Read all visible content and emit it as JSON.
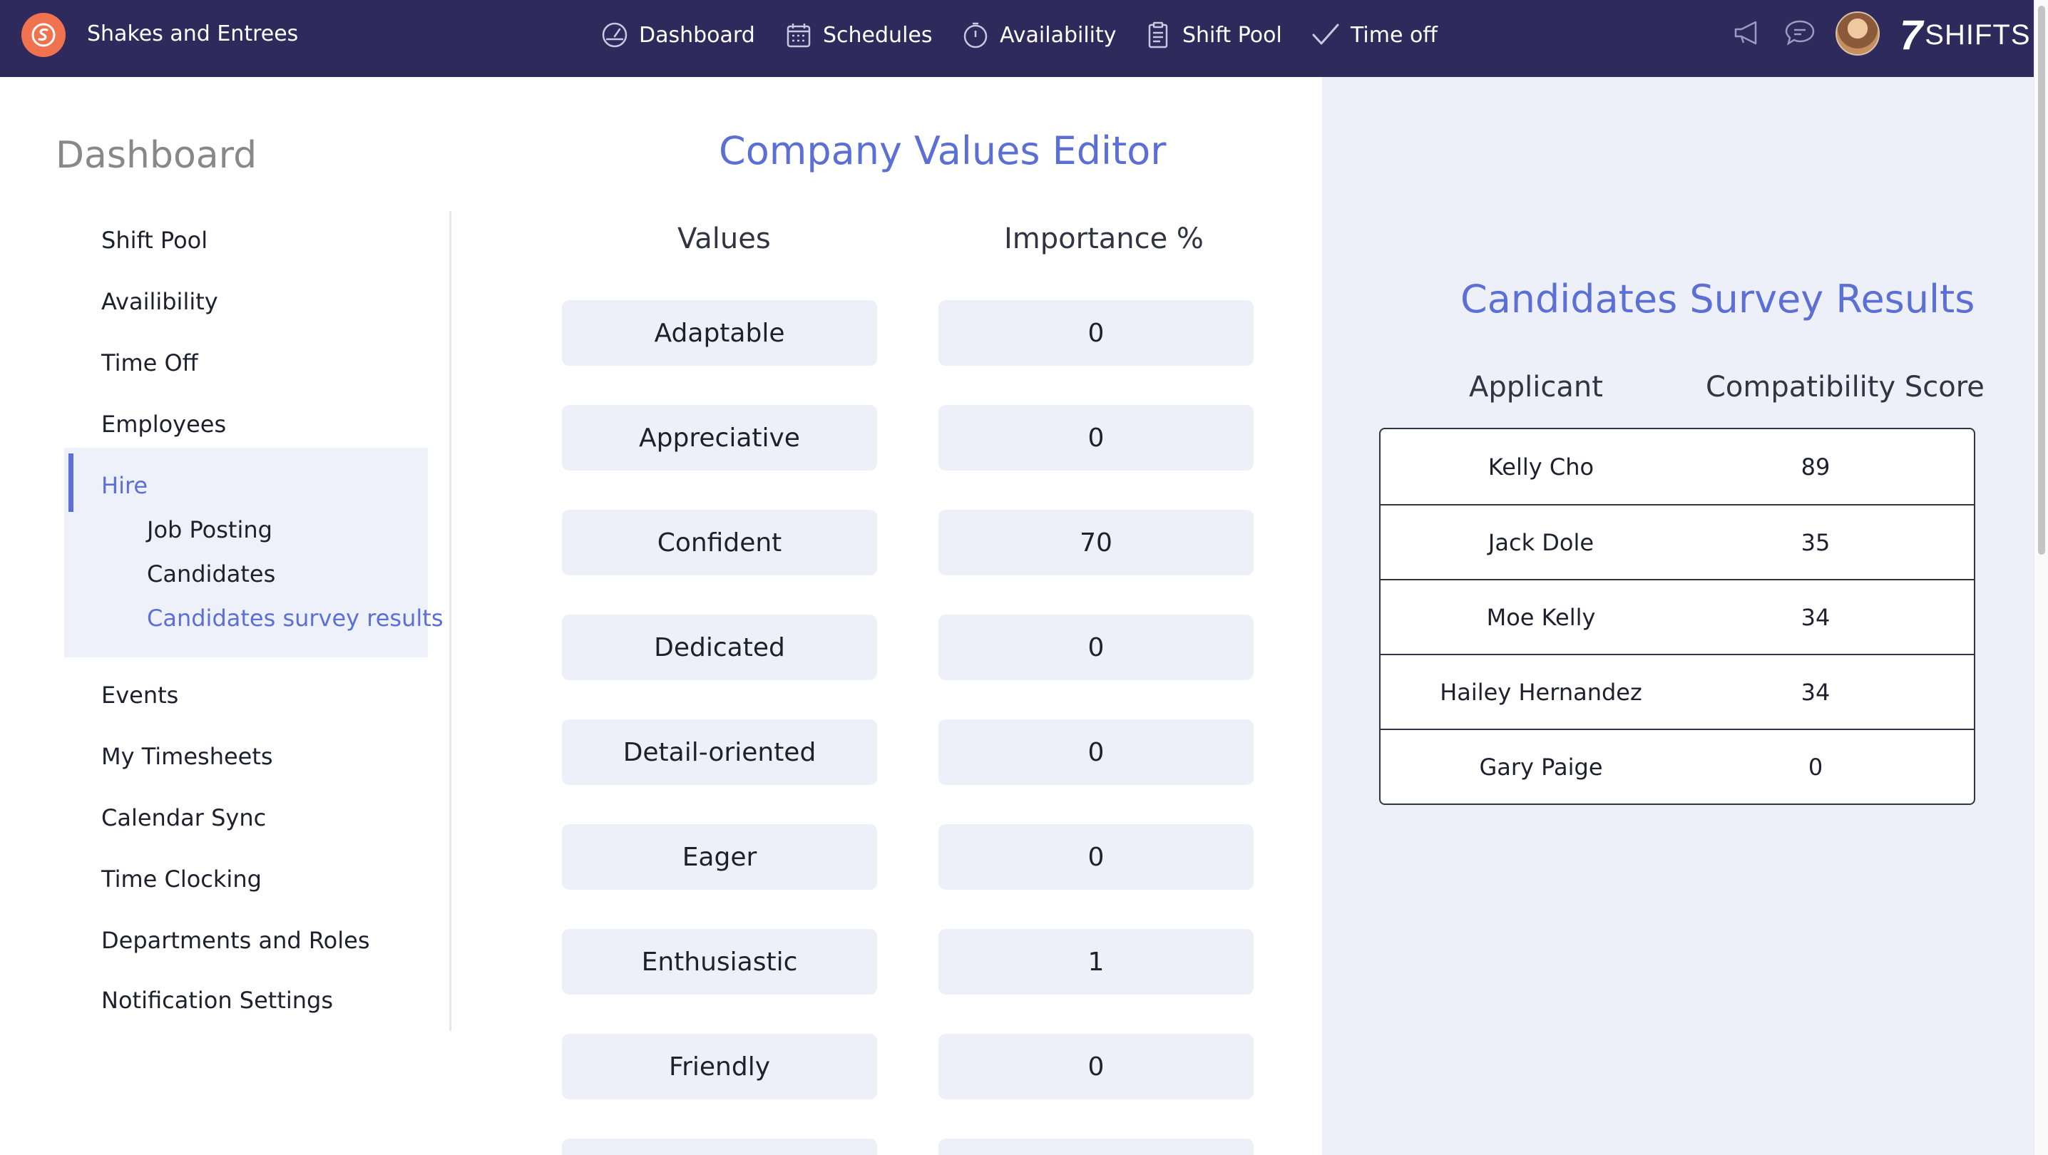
{
  "topbar": {
    "company_name": "Shakes and Entrees",
    "nav": [
      {
        "label": "Dashboard",
        "icon": "dashboard-gauge-icon"
      },
      {
        "label": "Schedules",
        "icon": "calendar-icon"
      },
      {
        "label": "Availability",
        "icon": "stopwatch-icon"
      },
      {
        "label": "Shift Pool",
        "icon": "clipboard-icon"
      },
      {
        "label": "Time off",
        "icon": "checkmark-icon"
      }
    ],
    "icons": [
      "megaphone-icon",
      "chat-bubble-icon",
      "avatar",
      "7shifts-logo"
    ],
    "wordmark_seven": "7",
    "wordmark_text": "SHIFTS",
    "bg_color": "#2e2a5c",
    "logo_color": "#f0724e"
  },
  "sidebar": {
    "title": "Dashboard",
    "items": [
      "Shift Pool",
      "Availibility",
      "Time Off",
      "Employees"
    ],
    "hire": {
      "label": "Hire",
      "sub_items": [
        "Job Posting",
        "Candidates",
        "Candidates survey results"
      ]
    },
    "items_after": [
      "Events",
      "My Timesheets",
      "Calendar Sync",
      "Time Clocking",
      "Departments and Roles",
      "Notification Settings"
    ],
    "accent_color": "#5b6fd4"
  },
  "values_editor": {
    "title": "Company Values Editor",
    "col_values": "Values",
    "col_importance": "Importance %",
    "rows": [
      {
        "value": "Adaptable",
        "importance": "0"
      },
      {
        "value": "Appreciative",
        "importance": "0"
      },
      {
        "value": "Confident",
        "importance": "70"
      },
      {
        "value": "Dedicated",
        "importance": "0"
      },
      {
        "value": "Detail-oriented",
        "importance": "0"
      },
      {
        "value": "Eager",
        "importance": "0"
      },
      {
        "value": "Enthusiastic",
        "importance": "1"
      },
      {
        "value": "Friendly",
        "importance": "0"
      },
      {
        "value": "",
        "importance": ""
      }
    ]
  },
  "survey_results": {
    "title": "Candidates Survey Results",
    "col_applicant": "Applicant",
    "col_score": "Compatibility Score",
    "rows": [
      {
        "name": "Kelly Cho",
        "score": "89"
      },
      {
        "name": "Jack Dole",
        "score": "35"
      },
      {
        "name": "Moe Kelly",
        "score": "34"
      },
      {
        "name": "Hailey Hernandez",
        "score": "34"
      },
      {
        "name": "Gary Paige",
        "score": "0"
      }
    ]
  }
}
